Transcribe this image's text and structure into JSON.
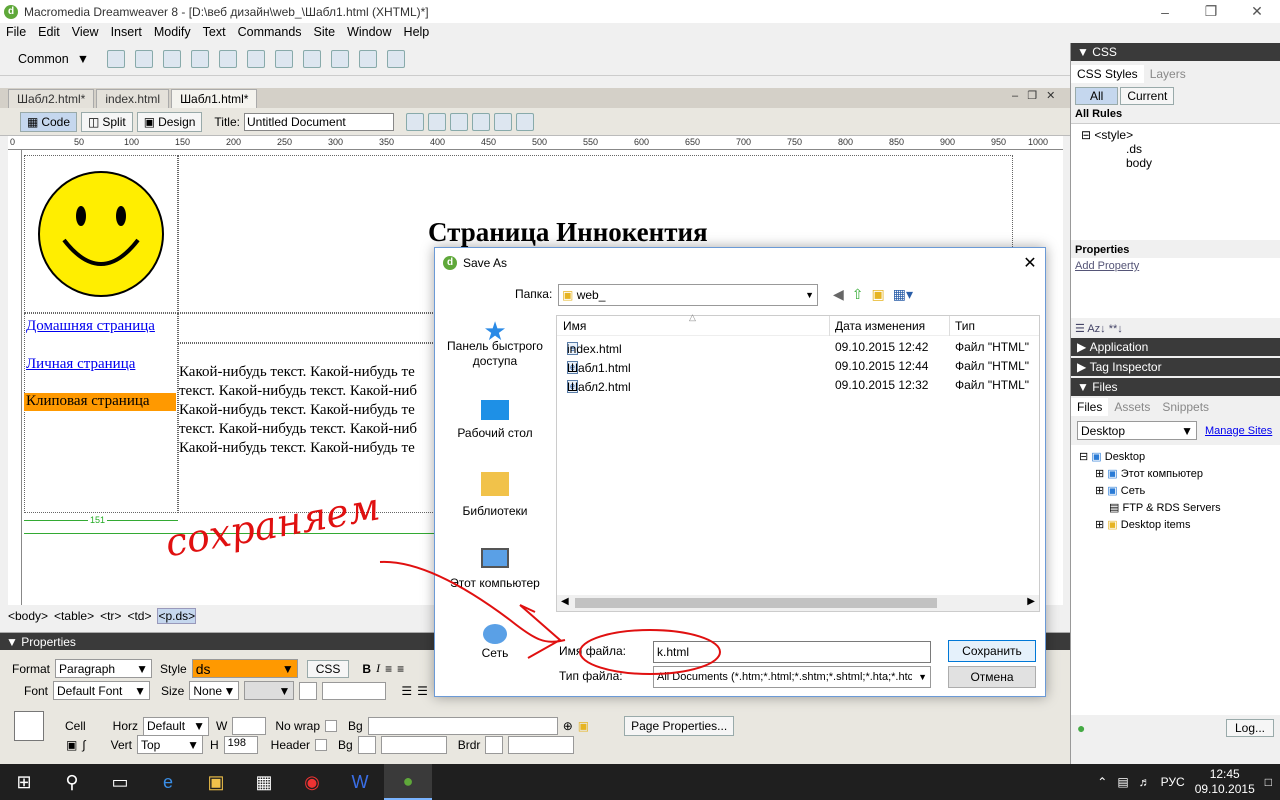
{
  "window": {
    "title": "Macromedia Dreamweaver 8 - [D:\\веб дизайн\\web_\\Шабл1.html (XHTML)*]"
  },
  "menu": [
    "File",
    "Edit",
    "View",
    "Insert",
    "Modify",
    "Text",
    "Commands",
    "Site",
    "Window",
    "Help"
  ],
  "toolbar": {
    "category": "Common"
  },
  "doc_tabs": [
    "Шабл2.html*",
    "index.html",
    "Шабл1.html*"
  ],
  "doc_toolbar": {
    "code": "Code",
    "split": "Split",
    "design": "Design",
    "title_label": "Title:",
    "title_value": "Untitled Document"
  },
  "ruler_ticks": [
    "0",
    "50",
    "100",
    "150",
    "200",
    "250",
    "300",
    "350",
    "400",
    "450",
    "500",
    "550",
    "600",
    "650",
    "700",
    "750",
    "800",
    "850",
    "900",
    "950",
    "1000"
  ],
  "page": {
    "heading": "Страница Иннокентия",
    "links": [
      "Домашняя страница",
      "Личная страница"
    ],
    "active_link": "Клиповая страница",
    "body_lines": [
      "Какой-нибудь текст. Какой-нибудь те",
      "текст. Какой-нибудь текст. Какой-ниб",
      "Какой-нибудь текст. Какой-нибудь те",
      "текст. Какой-нибудь текст. Какой-ниб",
      "Какой-нибудь текст. Какой-нибудь те"
    ],
    "col_width": "151"
  },
  "annotation": "сохраняем",
  "tag_selector": [
    "<body>",
    "<table>",
    "<tr>",
    "<td>",
    "<p.ds>"
  ],
  "properties": {
    "header": "Properties",
    "format_label": "Format",
    "format_value": "Paragraph",
    "style_label": "Style",
    "style_value": "ds",
    "css_button": "CSS",
    "font_label": "Font",
    "font_value": "Default Font",
    "size_label": "Size",
    "size_value": "None",
    "cell_label": "Cell",
    "horz_label": "Horz",
    "horz_value": "Default",
    "w_label": "W",
    "nowrap_label": "No wrap",
    "bg_label": "Bg",
    "page_props_button": "Page Properties...",
    "vert_label": "Vert",
    "vert_value": "Top",
    "h_label": "H",
    "h_value": "198",
    "header_label": "Header",
    "brdr_label": "Brdr"
  },
  "right_panel": {
    "css_header": "CSS",
    "tabs": [
      "CSS Styles",
      "Layers"
    ],
    "subtabs": [
      "All",
      "Current"
    ],
    "all_rules": "All Rules",
    "rules": [
      "<style>",
      ".ds",
      "body"
    ],
    "properties_header": "Properties",
    "add_property": "Add Property",
    "application": "Application",
    "tag_inspector": "Tag Inspector",
    "files_header": "Files",
    "files_tabs": [
      "Files",
      "Assets",
      "Snippets"
    ],
    "site_select": "Desktop",
    "manage_sites": "Manage Sites",
    "tree": [
      "Desktop",
      "Этот компьютер",
      "Сеть",
      "FTP & RDS Servers",
      "Desktop items"
    ],
    "log_button": "Log..."
  },
  "dialog": {
    "title": "Save As",
    "folder_label": "Папка:",
    "folder_value": "web_",
    "places": [
      "Панель быстрого доступа",
      "Рабочий стол",
      "Библиотеки",
      "Этот компьютер",
      "Сеть"
    ],
    "columns": [
      "Имя",
      "Дата изменения",
      "Тип"
    ],
    "files": [
      {
        "name": "index.html",
        "date": "09.10.2015 12:42",
        "type": "Файл \"HTML\""
      },
      {
        "name": "Шабл1.html",
        "date": "09.10.2015 12:44",
        "type": "Файл \"HTML\""
      },
      {
        "name": "Шабл2.html",
        "date": "09.10.2015 12:32",
        "type": "Файл \"HTML\""
      }
    ],
    "filename_label": "Имя файла:",
    "filename_value": "k.html",
    "filetype_label": "Тип файла:",
    "filetype_value": "All Documents (*.htm;*.html;*.shtm;*.shtml;*.hta;*.htc;*.x",
    "save_button": "Сохранить",
    "cancel_button": "Отмена"
  },
  "taskbar": {
    "lang": "РУС",
    "time": "12:45",
    "date": "09.10.2015"
  },
  "colors": {
    "highlight": "#ff9900",
    "accent": "#3a3a3a",
    "annotation": "#e01010",
    "link": "#0000ee"
  }
}
